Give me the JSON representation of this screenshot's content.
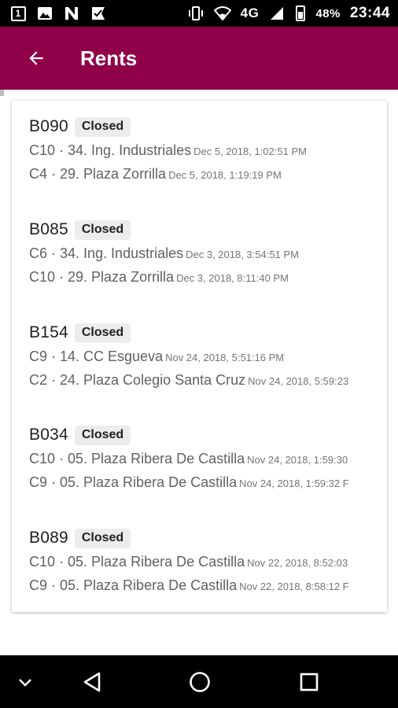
{
  "status_bar": {
    "notification_badge": "1",
    "network": "4G",
    "battery": "48%",
    "time": "23:44"
  },
  "app_bar": {
    "title": "Rents",
    "color": "#8f0049"
  },
  "rents": [
    {
      "id": "B090",
      "status": "Closed",
      "legs": [
        {
          "station": "C10 · 34. Ing. Industriales",
          "time": "Dec 5, 2018, 1:02:51 PM"
        },
        {
          "station": "C4 · 29. Plaza Zorrilla",
          "time": "Dec 5, 2018, 1:19:19 PM"
        }
      ]
    },
    {
      "id": "B085",
      "status": "Closed",
      "legs": [
        {
          "station": "C6 · 34. Ing. Industriales",
          "time": "Dec 3, 2018, 3:54:51 PM"
        },
        {
          "station": "C10 · 29. Plaza Zorrilla",
          "time": "Dec 3, 2018, 8:11:40 PM"
        }
      ]
    },
    {
      "id": "B154",
      "status": "Closed",
      "legs": [
        {
          "station": "C9 · 14. CC Esgueva",
          "time": "Nov 24, 2018, 5:51:16 PM"
        },
        {
          "station": "C2 · 24. Plaza Colegio Santa Cruz",
          "time": "Nov 24, 2018, 5:59:23"
        }
      ]
    },
    {
      "id": "B034",
      "status": "Closed",
      "legs": [
        {
          "station": "C10 · 05. Plaza Ribera De Castilla",
          "time": "Nov 24, 2018, 1:59:30"
        },
        {
          "station": "C9 · 05. Plaza Ribera De Castilla",
          "time": "Nov 24, 2018, 1:59:32 F"
        }
      ]
    },
    {
      "id": "B089",
      "status": "Closed",
      "legs": [
        {
          "station": "C10 · 05. Plaza Ribera De Castilla",
          "time": "Nov 22, 2018, 8:52:03"
        },
        {
          "station": "C9 · 05. Plaza Ribera De Castilla",
          "time": "Nov 22, 2018, 8:58:12 F"
        }
      ]
    }
  ],
  "icons": {
    "back": "arrow-left-icon",
    "nav_down": "chevron-down-icon",
    "nav_back": "triangle-back-icon",
    "nav_home": "circle-home-icon",
    "nav_recents": "square-recents-icon"
  }
}
